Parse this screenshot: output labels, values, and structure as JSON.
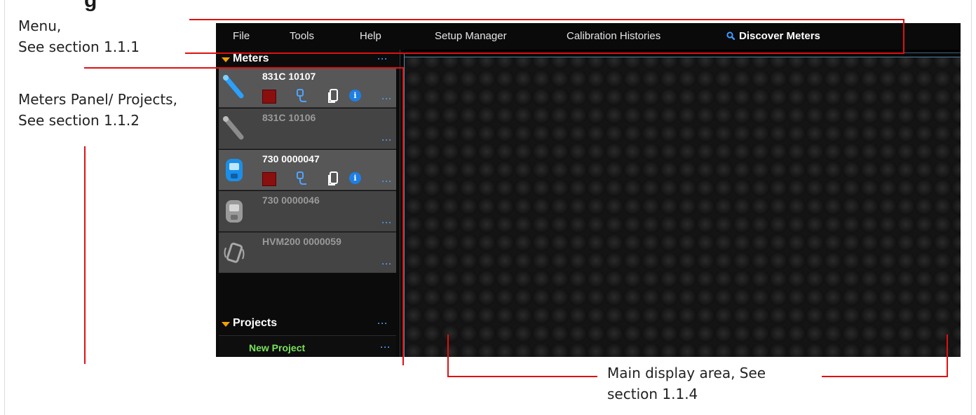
{
  "document": {
    "clipped_heading": "g",
    "callouts": {
      "menu": [
        "Menu,",
        "See section 1.1.1"
      ],
      "meters_panel": [
        "Meters Panel/ Projects,",
        "See section 1.1.2"
      ],
      "main_display": [
        "Main display area, See",
        "section 1.1.4"
      ]
    },
    "line_color": "#e01010"
  },
  "app": {
    "menu": {
      "items": [
        "File",
        "Tools",
        "Help",
        "Setup Manager",
        "Calibration Histories"
      ],
      "discover_label": "Discover Meters",
      "discover_icon": "search-icon"
    },
    "meters_panel": {
      "title": "Meters",
      "more_label": "···",
      "meters": [
        {
          "name": "831C 10107",
          "status": "connected",
          "icon": "sound-level-meter-icon"
        },
        {
          "name": "831C 10106",
          "status": "disconnected",
          "icon": "sound-level-meter-icon"
        },
        {
          "name": "730 0000047",
          "status": "connected",
          "icon": "noise-dosimeter-icon"
        },
        {
          "name": "730 0000046",
          "status": "disconnected",
          "icon": "noise-dosimeter-icon"
        },
        {
          "name": "HVM200 0000059",
          "status": "disconnected",
          "icon": "vibration-meter-icon"
        }
      ]
    },
    "projects_panel": {
      "title": "Projects",
      "more_label": "···",
      "items": [
        {
          "name": "New Project"
        }
      ]
    },
    "colors": {
      "accent_orange": "#f5a000",
      "link_blue": "#4fa3ff",
      "project_green": "#79e35b",
      "stop_red": "#8a0f0f"
    }
  }
}
